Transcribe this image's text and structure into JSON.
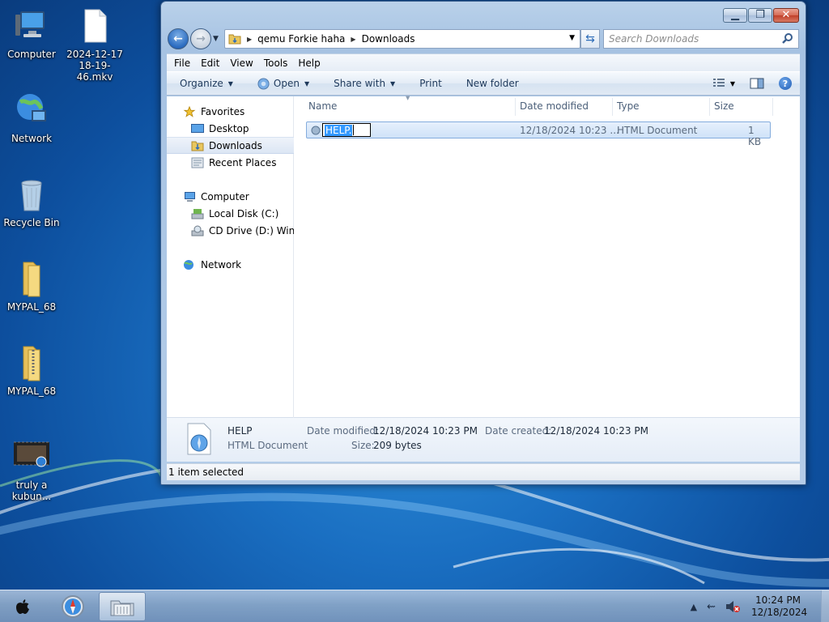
{
  "desktop": {
    "icons": [
      {
        "label": "Computer"
      },
      {
        "label": "2024-12-17 18-19-46.mkv"
      },
      {
        "label": "Network"
      },
      {
        "label": "Recycle Bin"
      },
      {
        "label": "MYPAL_68"
      },
      {
        "label": "MYPAL_68"
      },
      {
        "label": "truly a kubun..."
      }
    ]
  },
  "window": {
    "address": {
      "crumbs": [
        "qemu Forkie haha",
        "Downloads"
      ]
    },
    "search": {
      "placeholder": "Search Downloads"
    },
    "menu": [
      "File",
      "Edit",
      "View",
      "Tools",
      "Help"
    ],
    "toolbar": {
      "organize": "Organize",
      "open": "Open",
      "share": "Share with",
      "print": "Print",
      "new_folder": "New folder"
    },
    "navpane": {
      "favorites": "Favorites",
      "desktop": "Desktop",
      "downloads": "Downloads",
      "recent": "Recent Places",
      "computer": "Computer",
      "local_disk": "Local Disk (C:)",
      "cd_drive": "CD Drive (D:) Windo",
      "network": "Network"
    },
    "columns": {
      "name": "Name",
      "date": "Date modified",
      "type": "Type",
      "size": "Size"
    },
    "files": [
      {
        "rename_value": "HELP.",
        "date": "12/18/2024 10:23 ...",
        "type": "HTML Document",
        "size": "1 KB"
      }
    ],
    "details": {
      "name": "HELP",
      "kind": "HTML Document",
      "modified_label": "Date modified:",
      "modified_value": "12/18/2024 10:23 PM",
      "created_label": "Date created:",
      "created_value": "12/18/2024 10:23 PM",
      "size_label": "Size:",
      "size_value": "209 bytes"
    },
    "status": "1 item selected"
  },
  "taskbar": {
    "time": "10:24 PM",
    "date": "12/18/2024"
  }
}
